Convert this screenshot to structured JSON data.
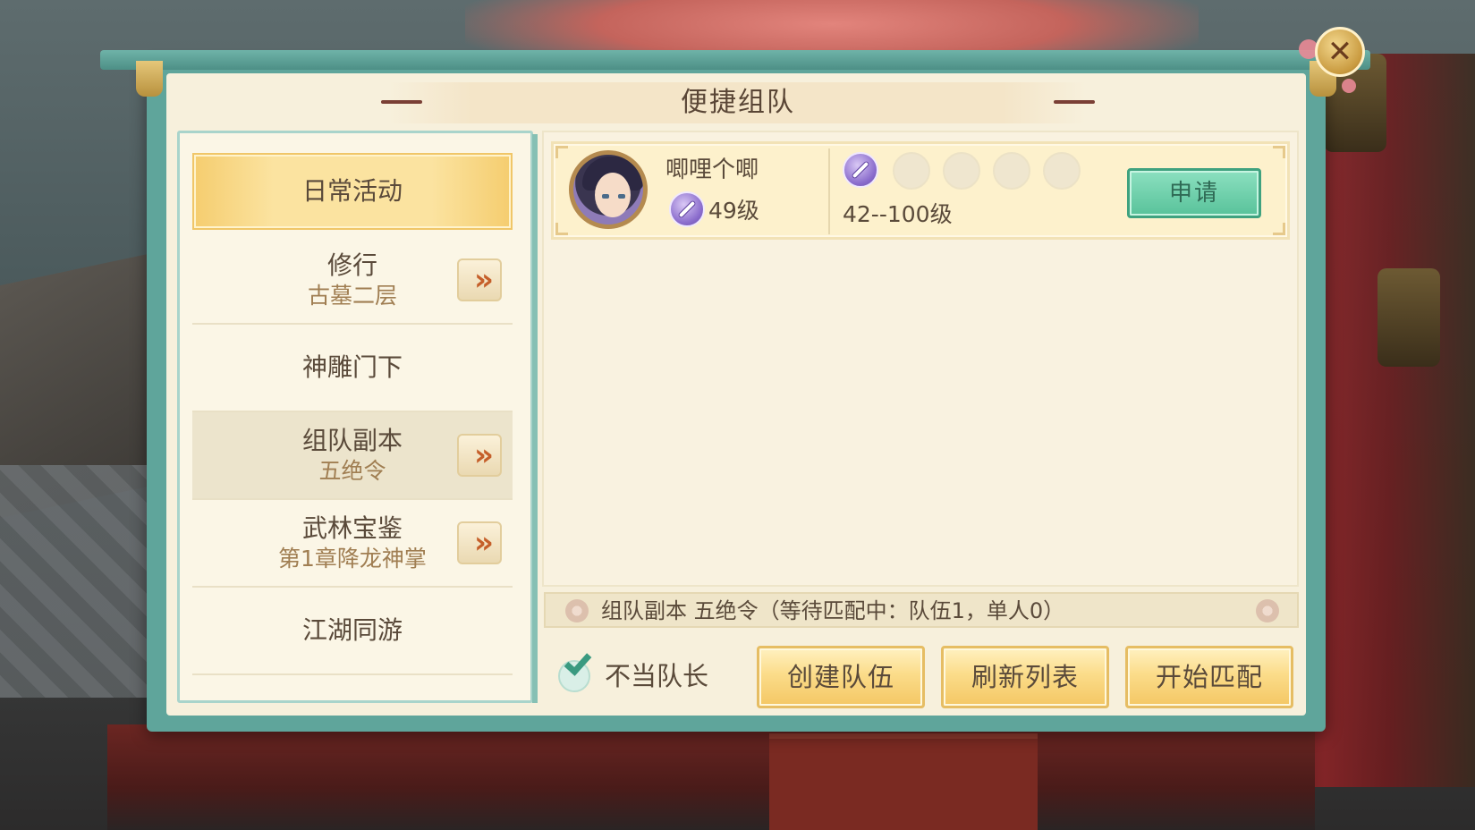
{
  "window": {
    "title": "便捷组队"
  },
  "sidebar": {
    "items": [
      {
        "label": "日常活动",
        "sub": "",
        "state": "selected",
        "has_arrow": false
      },
      {
        "label": "修行",
        "sub": "古墓二层",
        "state": "normal",
        "has_arrow": true
      },
      {
        "label": "神雕门下",
        "sub": "",
        "state": "normal",
        "has_arrow": false
      },
      {
        "label": "组队副本",
        "sub": "五绝令",
        "state": "active",
        "has_arrow": true
      },
      {
        "label": "武林宝鉴",
        "sub": "第1章降龙神掌",
        "state": "normal",
        "has_arrow": true
      },
      {
        "label": "江湖同游",
        "sub": "",
        "state": "normal",
        "has_arrow": false
      }
    ],
    "arrow_icon": "double-chevron-right-icon"
  },
  "team_list": {
    "teams": [
      {
        "leader_name": "唧哩个唧",
        "leader_level": "49级",
        "class_icon": "purple-sword-class-icon",
        "level_range": "42--100级",
        "members_filled": 1,
        "members_total": 5,
        "apply_label": "申请"
      }
    ]
  },
  "status": {
    "text": "组队副本 五绝令（等待匹配中：队伍1，单人0）"
  },
  "controls": {
    "not_leader_label": "不当队长",
    "not_leader_checked": true,
    "create_team_label": "创建队伍",
    "refresh_list_label": "刷新列表",
    "start_match_label": "开始匹配"
  },
  "colors": {
    "frame_teal": "#5fa59b",
    "panel_cream": "#f7f0dc",
    "button_gold": "#fbdc8a",
    "apply_green": "#58c29a",
    "text_brown": "#5a4a3a"
  }
}
